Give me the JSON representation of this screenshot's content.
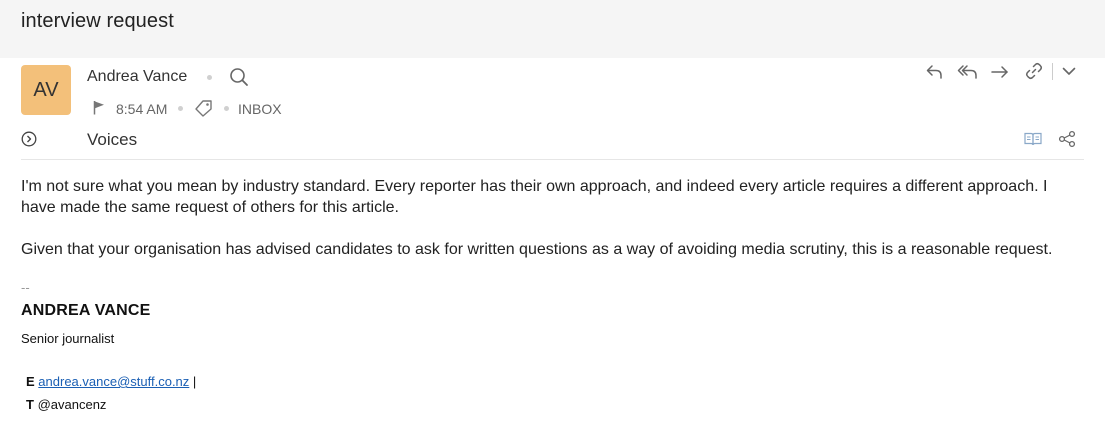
{
  "email": {
    "title": "interview request",
    "sender": {
      "initials": "AV",
      "name": "Andrea Vance",
      "avatar_color": "#f3c07a"
    },
    "meta": {
      "time": "8:54 AM",
      "folder": "INBOX"
    },
    "subject": "Voices",
    "body": {
      "paragraph1": "I'm not sure what you mean by industry standard. Every reporter has their own approach, and indeed every article requires a different approach. I have made the same request of others for this article.",
      "paragraph2": "Given that your organisation has advised candidates to ask for written questions as a way of avoiding media scrutiny, this is a reasonable request."
    },
    "signature": {
      "separator": "--",
      "name": "ANDREA VANCE",
      "role": "Senior journalist",
      "email_label": "E",
      "email": "andrea.vance@stuff.co.nz",
      "email_suffix": "|",
      "twitter_label": "T",
      "twitter": "@avancenz"
    }
  },
  "toolbar": {
    "icons": [
      "reply-icon",
      "reply-all-icon",
      "forward-icon",
      "link-icon",
      "chevron-down-icon"
    ],
    "secondary_icons": [
      "reader-view-icon",
      "share-icon"
    ]
  },
  "colors": {
    "accent_link": "#1a5fb4",
    "title_bar_bg": "#f5f5f5",
    "icon_gray": "#666666"
  }
}
